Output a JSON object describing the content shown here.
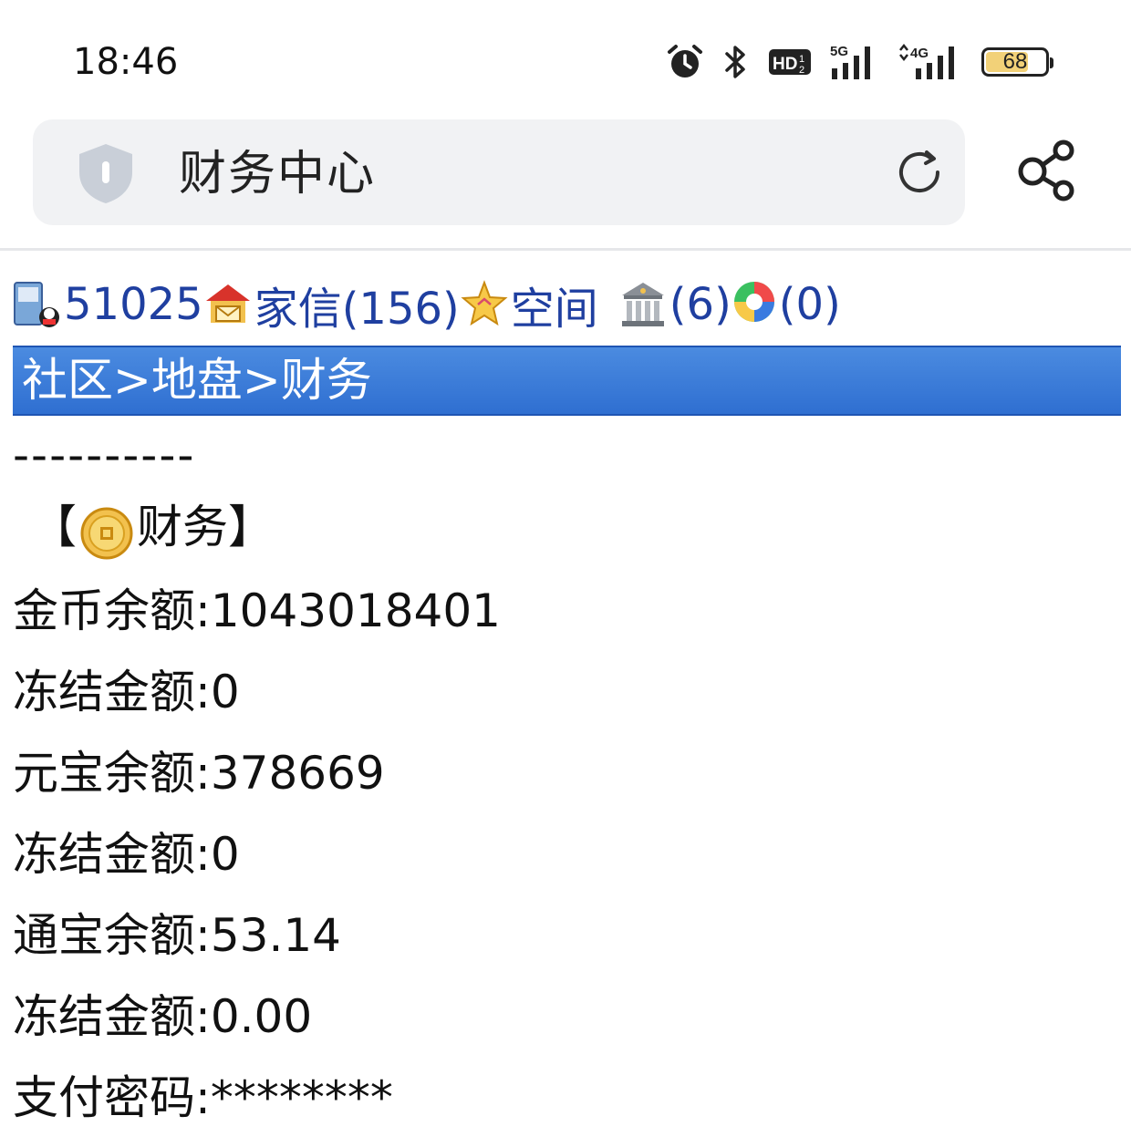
{
  "status_bar": {
    "time": "18:46",
    "icons": [
      "alarm-icon",
      "bluetooth-icon",
      "hd-voice-icon",
      "5g-signal-icon",
      "4g-signal-icon"
    ],
    "battery_percent": "68"
  },
  "address_bar": {
    "title": "财务中心",
    "shield_icon": "shield-icon",
    "reload_icon": "reload-icon"
  },
  "share_icon": "share-icon",
  "top_links": {
    "user_id": "51025",
    "mail_label": "家信(156)",
    "space_label": "空间",
    "bank_label": "(6)",
    "colorful_label": "(0)"
  },
  "breadcrumb": {
    "community": "社区",
    "separator": ">",
    "territory": "地盘",
    "finance": "财务"
  },
  "content": {
    "dashes": "----------",
    "section_open": "【",
    "section_title": "财务",
    "section_close": "】",
    "rows": [
      "金币余额:1043018401",
      "冻结金额:0",
      "元宝余额:378669",
      "冻结金额:0",
      "通宝余额:53.14",
      "冻结金额:0.00",
      "支付密码:********"
    ]
  },
  "colors": {
    "link_blue": "#1f3fa0",
    "breadcrumb_blue": "#2f6fd1",
    "battery_fill": "#f2d178"
  }
}
